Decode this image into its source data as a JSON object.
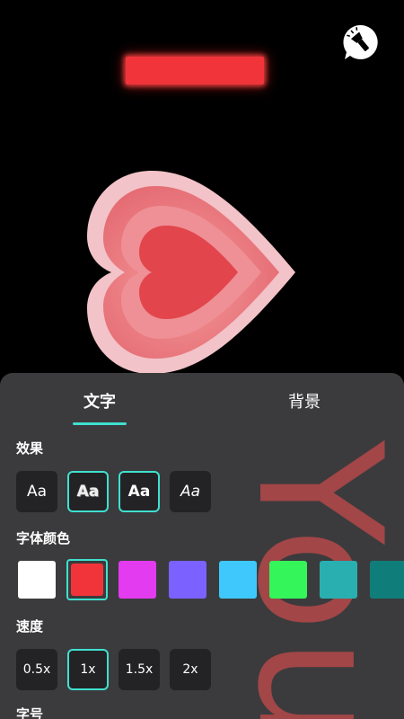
{
  "preview": {
    "led_color": "#f0343a"
  },
  "tabs": [
    {
      "label": "文字",
      "active": true
    },
    {
      "label": "背景",
      "active": false
    }
  ],
  "ghost_text": "You",
  "effects": {
    "title": "效果",
    "items": [
      {
        "label": "Aa",
        "style": "normal",
        "selected": false
      },
      {
        "label": "Aa",
        "style": "outline",
        "selected": true
      },
      {
        "label": "Aa",
        "style": "bold",
        "selected": true
      },
      {
        "label": "Aa",
        "style": "italic",
        "selected": false
      }
    ]
  },
  "font_color": {
    "title": "字体颜色",
    "colors": [
      "#ffffff",
      "#f0343a",
      "#e23bf0",
      "#7b61ff",
      "#3ec8fb",
      "#34f55a",
      "#2aafb0",
      "#0f7e7a"
    ],
    "selected_index": 1
  },
  "speed": {
    "title": "速度",
    "options": [
      "0.5x",
      "1x",
      "1.5x",
      "2x"
    ],
    "selected_index": 1
  },
  "font_size": {
    "title": "字号"
  }
}
